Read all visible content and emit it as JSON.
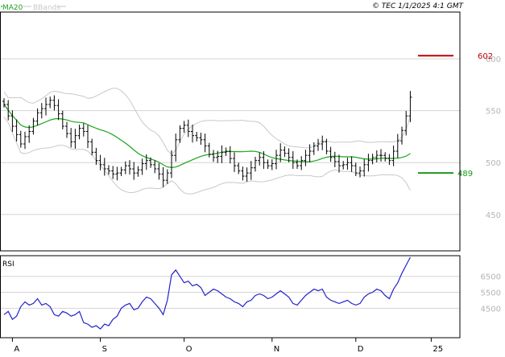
{
  "header": {
    "legend_ma": "MA20",
    "legend_bb": "BBands",
    "credit": "© TEC 1/1/2025 4:1 GMT"
  },
  "colors": {
    "ma": "#1aa51a",
    "bands": "#c8c8c8",
    "bars": "#000000",
    "rsi": "#2222cc",
    "resistance": "#bb0000",
    "support": "#1a9a1a",
    "grid": "#d4d4d4",
    "frame": "#000000",
    "tick_text": "#b4b4b4"
  },
  "chart_data": [
    {
      "type": "ohlc",
      "panel": "price",
      "ylim": [
        415,
        645
      ],
      "y_ticks": [
        450,
        500,
        550,
        600
      ],
      "y_tick_labels": [
        "450",
        "500",
        "550",
        "600"
      ],
      "x_tick_labels": [
        "A",
        "S",
        "O",
        "N",
        "D",
        "25"
      ],
      "x_tick_index": [
        2,
        23,
        43,
        64,
        84,
        102
      ],
      "grid": true,
      "series": [
        {
          "name": "MA20",
          "indicator": "moving-average"
        },
        {
          "name": "BBands",
          "indicator": "bollinger-bands"
        }
      ],
      "levels": [
        {
          "label": "602",
          "value": 603,
          "kind": "resistance"
        },
        {
          "label": "489",
          "value": 490,
          "kind": "support"
        }
      ],
      "close": [
        556,
        545,
        535,
        527,
        518,
        525,
        530,
        540,
        548,
        552,
        556,
        560,
        555,
        547,
        535,
        528,
        520,
        526,
        533,
        530,
        520,
        510,
        502,
        498,
        494,
        492,
        489,
        490,
        493,
        497,
        494,
        490,
        493,
        499,
        502,
        498,
        494,
        489,
        483,
        490,
        507,
        522,
        533,
        536,
        530,
        526,
        524,
        522,
        516,
        508,
        505,
        506,
        510,
        511,
        504,
        497,
        492,
        487,
        490,
        495,
        502,
        505,
        500,
        497,
        499,
        507,
        512,
        509,
        505,
        500,
        497,
        502,
        507,
        511,
        516,
        518,
        520,
        511,
        505,
        501,
        497,
        498,
        500,
        497,
        490,
        492,
        498,
        502,
        505,
        507,
        507,
        504,
        502,
        511,
        521,
        531,
        545,
        563
      ]
    },
    {
      "type": "line",
      "panel": "rsi",
      "title": "RSI",
      "ylim": [
        28,
        78
      ],
      "y_ticks": [
        45,
        55,
        65
      ],
      "y_tick_labels": [
        "4500",
        "5500",
        "6500"
      ],
      "x_tick_labels": [
        "A",
        "S",
        "O",
        "N",
        "D",
        "25"
      ],
      "grid": true,
      "values": [
        41,
        43,
        38,
        40,
        46,
        49,
        47,
        48,
        51,
        47,
        48,
        46,
        41,
        40,
        43,
        42,
        40,
        41,
        43,
        36,
        35,
        33,
        34,
        32,
        35,
        34,
        38,
        40,
        45,
        47,
        48,
        44,
        45,
        49,
        52,
        51,
        48,
        45,
        41,
        50,
        66,
        69,
        65,
        61,
        62,
        59,
        60,
        58,
        53,
        55,
        57,
        56,
        54,
        52,
        51,
        49,
        48,
        46,
        49,
        50,
        53,
        54,
        53,
        51,
        52,
        54,
        56,
        54,
        52,
        48,
        47,
        50,
        53,
        55,
        57,
        56,
        57,
        52,
        50,
        49,
        48,
        49,
        50,
        48,
        47,
        48,
        52,
        54,
        55,
        57,
        56,
        53,
        51,
        57,
        61,
        67,
        72,
        77
      ]
    }
  ]
}
